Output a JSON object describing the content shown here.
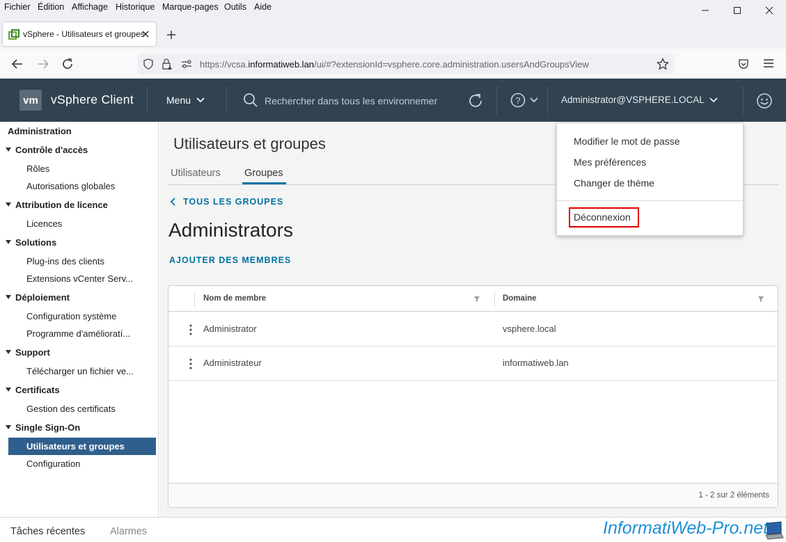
{
  "menubar": {
    "items": [
      "Fichier",
      "Édition",
      "Affichage",
      "Historique",
      "Marque-pages",
      "Outils",
      "Aide"
    ]
  },
  "tab": {
    "title": "vSphere - Utilisateurs et groupes"
  },
  "urlbar": {
    "url_prefix": "https://vcsa.",
    "url_domain": "informatiweb.lan",
    "url_suffix": "/ui/#?extensionId=vsphere.core.administration.usersAndGroupsView"
  },
  "header": {
    "logo": "vm",
    "app_title": "vSphere Client",
    "menu_label": "Menu",
    "search_placeholder": "Rechercher dans tous les environnemer",
    "user": "Administrator@VSPHERE.LOCAL",
    "color": "#314351"
  },
  "sidebar": {
    "title": "Administration",
    "sections": [
      {
        "label": "Contrôle d'accès",
        "items": [
          "Rôles",
          "Autorisations globales"
        ]
      },
      {
        "label": "Attribution de licence",
        "items": [
          "Licences"
        ]
      },
      {
        "label": "Solutions",
        "items": [
          "Plug-ins des clients",
          "Extensions vCenter Serv..."
        ]
      },
      {
        "label": "Déploiement",
        "items": [
          "Configuration système",
          "Programme d'amélioratí..."
        ]
      },
      {
        "label": "Support",
        "items": [
          "Télécharger un fichier ve..."
        ]
      },
      {
        "label": "Certificats",
        "items": [
          "Gestion des certificats"
        ]
      },
      {
        "label": "Single Sign-On",
        "items": [
          "Utilisateurs et groupes",
          "Configuration"
        ]
      }
    ],
    "selected": "Utilisateurs et groupes",
    "selected_color": "#2f5f8d"
  },
  "main": {
    "page_title": "Utilisateurs et groupes",
    "tabs": [
      "Utilisateurs",
      "Groupes"
    ],
    "active_tab": "Groupes",
    "back_link": "TOUS LES GROUPES",
    "group_name": "Administrators",
    "add_members": "AJOUTER DES MEMBRES",
    "grid": {
      "columns": [
        "Nom de membre",
        "Domaine"
      ],
      "rows": [
        {
          "name": "Administrator",
          "domain": "vsphere.local"
        },
        {
          "name": "Administrateur",
          "domain": "informatiweb.lan"
        }
      ],
      "footer": "1 - 2 sur 2 éléments"
    },
    "accent": "#0072a3"
  },
  "dropdown": {
    "items": [
      "Modifier le mot de passe",
      "Mes préférences",
      "Changer de thème"
    ],
    "logout": "Déconnexion",
    "highlight_color": "#e00000"
  },
  "bottombar": {
    "tasks": "Tâches récentes",
    "alarms": "Alarmes"
  },
  "watermark": "InformatiWeb-Pro.net"
}
